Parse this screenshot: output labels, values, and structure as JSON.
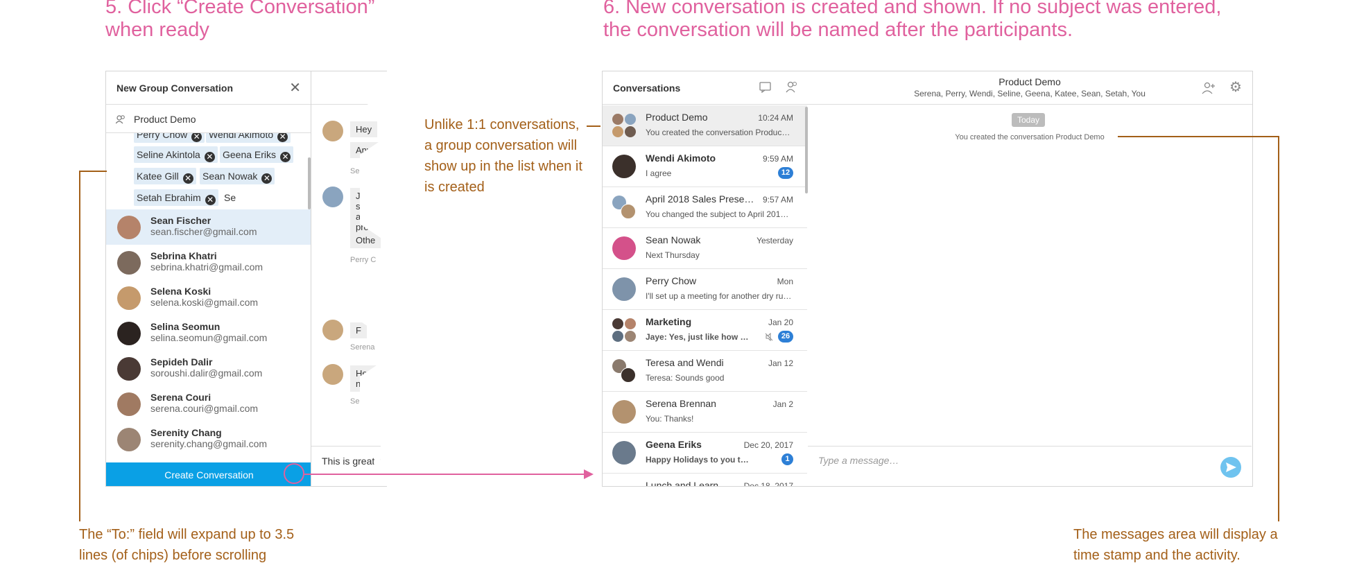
{
  "step5": {
    "line1": "5. Click “Create Conversation”",
    "line2": "when ready"
  },
  "step6": {
    "line1": "6. New conversation is created and shown. If no subject was entered,",
    "line2": "the conversation will be named after the participants."
  },
  "notes": {
    "to_field": {
      "line1": "The “To:” field will expand up to 3.5",
      "line2": "lines (of chips) before scrolling"
    },
    "group_list": {
      "line1": "Unlike 1:1 conversations,",
      "line2": "a group conversation will",
      "line3": "show up in the list when it",
      "line4": "is created"
    },
    "messages": {
      "line1": "The messages area will display a",
      "line2": "time stamp and the activity."
    }
  },
  "new_group": {
    "title": "New Group Conversation",
    "subject": "Product Demo",
    "chips_partial": [
      "Perry Chow",
      "Wendi Akimoto"
    ],
    "chips": [
      "Seline Akintola",
      "Geena Eriks",
      "Katee Gill",
      "Sean Nowak",
      "Setah Ebrahim"
    ],
    "typed": "Se",
    "suggestions": [
      {
        "name": "Sean Fischer",
        "email": "sean.fischer@gmail.com"
      },
      {
        "name": "Sebrina Khatri",
        "email": "sebrina.khatri@gmail.com"
      },
      {
        "name": "Selena Koski",
        "email": "selena.koski@gmail.com"
      },
      {
        "name": "Selina Seomun",
        "email": "selina.seomun@gmail.com"
      },
      {
        "name": "Sepideh Dalir",
        "email": "soroushi.dalir@gmail.com"
      },
      {
        "name": "Serena Couri",
        "email": "serena.couri@gmail.com"
      },
      {
        "name": "Serenity Chang",
        "email": "serenity.chang@gmail.com"
      }
    ],
    "create_label": "Create Conversation"
  },
  "bg_chat": {
    "b1": "Hey",
    "b2": "Anythi",
    "s1": "Seri",
    "b3a": "Janet s",
    "b3b": "and it",
    "b3c": "pro",
    "b4": "Othe",
    "s2": "Perry C",
    "b5": "F",
    "s3": "Serena",
    "b6a": "Hey",
    "b6b": "n",
    "s4": "Serena J",
    "composer": "This is great, u"
  },
  "conversations": {
    "header": "Conversations",
    "items": [
      {
        "title": "Product Demo",
        "time": "10:24 AM",
        "preview": "You created the conversation Produc…",
        "bold": false
      },
      {
        "title": "Wendi Akimoto",
        "time": "9:59 AM",
        "preview": "I agree",
        "bold": true,
        "badge": "12"
      },
      {
        "title": "April 2018 Sales Prese…",
        "time": "9:57 AM",
        "preview": "You changed the subject to April 201…",
        "bold": false
      },
      {
        "title": "Sean Nowak",
        "time": "Yesterday",
        "preview": "Next Thursday",
        "bold": false
      },
      {
        "title": "Perry Chow",
        "time": "Mon",
        "preview": "I'll set up a meeting for another dry ru…",
        "bold": false
      },
      {
        "title": "Marketing",
        "time": "Jan 20",
        "preview": "Jaye: Yes, just like how it …",
        "bold": true,
        "badge": "26"
      },
      {
        "title": "Teresa and Wendi",
        "time": "Jan 12",
        "preview": "Teresa: Sounds good",
        "bold": false
      },
      {
        "title": "Serena Brennan",
        "time": "Jan 2",
        "preview": "You: Thanks!",
        "bold": false
      },
      {
        "title": "Geena Eriks",
        "time": "Dec 20, 2017",
        "preview": "Happy Holidays to you too!",
        "bold": true,
        "badge": "1"
      },
      {
        "title": "Lunch and Learn",
        "time": "Dec 18, 2017",
        "preview": "",
        "bold": false
      }
    ]
  },
  "chat": {
    "title": "Product Demo",
    "participants": "Serena, Perry, Wendi, Seline, Geena, Katee, Sean, Setah, You",
    "today": "Today",
    "activity": "You created the conversation Product Demo",
    "placeholder": "Type a message…"
  },
  "colors": {
    "accent": "#0aa0e5",
    "pink": "#e0619e",
    "brown": "#a35f18",
    "badge": "#2d7fd6"
  }
}
